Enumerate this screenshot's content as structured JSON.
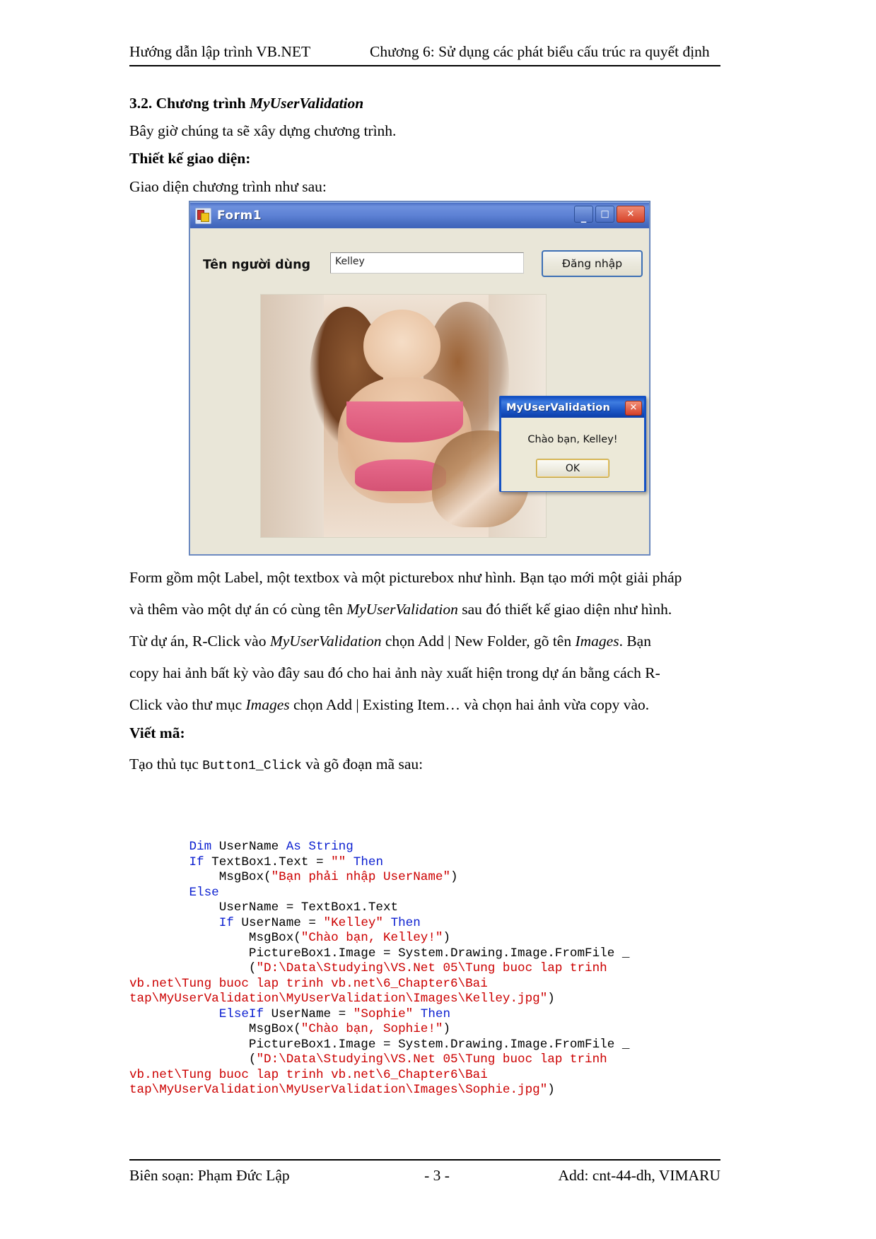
{
  "header": {
    "left": "Hướng dẫn lập trình VB.NET",
    "right": "Chương 6: Sử dụng các phát biểu cấu trúc ra quyết định"
  },
  "section": {
    "number_title_plain": "3.2. Chương trình ",
    "number_title_italic": "MyUserValidation",
    "intro": "Bây giờ chúng ta sẽ xây dựng chương trình.",
    "design_heading": "Thiết kế giao diện:",
    "design_caption": "Giao diện chương trình như sau:"
  },
  "vbform": {
    "title": "Form1",
    "icon": "vb-form-icon",
    "minimize_glyph": "_",
    "maximize_glyph": "□",
    "close_glyph": "✕",
    "label": "Tên người dùng",
    "textbox_value": "Kelley",
    "textbox_placeholder": "",
    "button_label": "Đăng nhập",
    "picturebox_alt": "picturebox-photo"
  },
  "msgbox": {
    "title": "MyUserValidation",
    "close_glyph": "✕",
    "message": "Chào bạn, Kelley!",
    "ok_label": "OK"
  },
  "paragraphs": {
    "p1_line1_a": "Form gồm một Label, một textbox và một picturebox như hình. Bạn tạo mới một giải pháp",
    "p1_line2_a": "và thêm vào một dự án có cùng tên ",
    "p1_line2_i": "MyUserValidation",
    "p1_line2_b": " sau đó thiết kế giao diện như hình.",
    "p2_line1_a": "Từ dự án, R-Click vào ",
    "p2_line1_i": "MyUserValidation",
    "p2_line1_b": " chọn Add | New Folder, gõ tên ",
    "p2_line1_i2": "Images",
    "p2_line1_c": ". Bạn",
    "p2_line2": "copy hai ảnh bất kỳ vào đây sau đó cho hai ảnh này xuất hiện trong dự án bằng cách R-",
    "p2_line3_a": "Click vào thư mục ",
    "p2_line3_i": "Images",
    "p2_line3_b": " chọn Add | Existing Item… và chọn hai ảnh vừa copy vào.",
    "code_heading": "Viết mã:",
    "code_caption_a": "Tạo thủ tục ",
    "code_caption_code": "Button1_Click",
    "code_caption_b": " và gõ đoạn mã sau:"
  },
  "code": {
    "lines": [
      [
        {
          "t": "        ",
          "c": "blk"
        },
        {
          "t": "Dim",
          "c": "kw"
        },
        {
          "t": " UserName ",
          "c": "blk"
        },
        {
          "t": "As String",
          "c": "kw"
        }
      ],
      [
        {
          "t": "        ",
          "c": "blk"
        },
        {
          "t": "If",
          "c": "kw"
        },
        {
          "t": " TextBox1.Text = ",
          "c": "blk"
        },
        {
          "t": "\"\"",
          "c": "str"
        },
        {
          "t": " ",
          "c": "blk"
        },
        {
          "t": "Then",
          "c": "kw"
        }
      ],
      [
        {
          "t": "            MsgBox(",
          "c": "blk"
        },
        {
          "t": "\"Bạn phải nhập UserName\"",
          "c": "str"
        },
        {
          "t": ")",
          "c": "blk"
        }
      ],
      [
        {
          "t": "        ",
          "c": "blk"
        },
        {
          "t": "Else",
          "c": "kw"
        }
      ],
      [
        {
          "t": "            UserName = TextBox1.Text",
          "c": "blk"
        }
      ],
      [
        {
          "t": "            ",
          "c": "blk"
        },
        {
          "t": "If",
          "c": "kw"
        },
        {
          "t": " UserName = ",
          "c": "blk"
        },
        {
          "t": "\"Kelley\"",
          "c": "str"
        },
        {
          "t": " ",
          "c": "blk"
        },
        {
          "t": "Then",
          "c": "kw"
        }
      ],
      [
        {
          "t": "                MsgBox(",
          "c": "blk"
        },
        {
          "t": "\"Chào bạn, Kelley!\"",
          "c": "str"
        },
        {
          "t": ")",
          "c": "blk"
        }
      ],
      [
        {
          "t": "                PictureBox1.Image = System.Drawing.Image.FromFile _",
          "c": "blk"
        }
      ],
      [
        {
          "t": "                (",
          "c": "blk"
        },
        {
          "t": "\"D:\\Data\\Studying\\VS.Net 05\\Tung buoc lap trinh",
          "c": "str"
        }
      ],
      [
        {
          "t": "vb.net\\Tung buoc lap trinh vb.net\\6_Chapter6\\Bai",
          "c": "str"
        }
      ],
      [
        {
          "t": "tap\\MyUserValidation\\MyUserValidation\\Images\\Kelley.jpg\"",
          "c": "str"
        },
        {
          "t": ")",
          "c": "blk"
        }
      ],
      [
        {
          "t": "            ",
          "c": "blk"
        },
        {
          "t": "ElseIf",
          "c": "kw"
        },
        {
          "t": " UserName = ",
          "c": "blk"
        },
        {
          "t": "\"Sophie\"",
          "c": "str"
        },
        {
          "t": " ",
          "c": "blk"
        },
        {
          "t": "Then",
          "c": "kw"
        }
      ],
      [
        {
          "t": "                MsgBox(",
          "c": "blk"
        },
        {
          "t": "\"Chào bạn, Sophie!\"",
          "c": "str"
        },
        {
          "t": ")",
          "c": "blk"
        }
      ],
      [
        {
          "t": "                PictureBox1.Image = System.Drawing.Image.FromFile _",
          "c": "blk"
        }
      ],
      [
        {
          "t": "                (",
          "c": "blk"
        },
        {
          "t": "\"D:\\Data\\Studying\\VS.Net 05\\Tung buoc lap trinh",
          "c": "str"
        }
      ],
      [
        {
          "t": "vb.net\\Tung buoc lap trinh vb.net\\6_Chapter6\\Bai",
          "c": "str"
        }
      ],
      [
        {
          "t": "tap\\MyUserValidation\\MyUserValidation\\Images\\Sophie.jpg\"",
          "c": "str"
        },
        {
          "t": ")",
          "c": "blk"
        }
      ]
    ]
  },
  "footer": {
    "left": "Biên soạn: Phạm Đức Lập",
    "center": "- 3 -",
    "right": "Add: cnt-44-dh, VIMARU"
  }
}
